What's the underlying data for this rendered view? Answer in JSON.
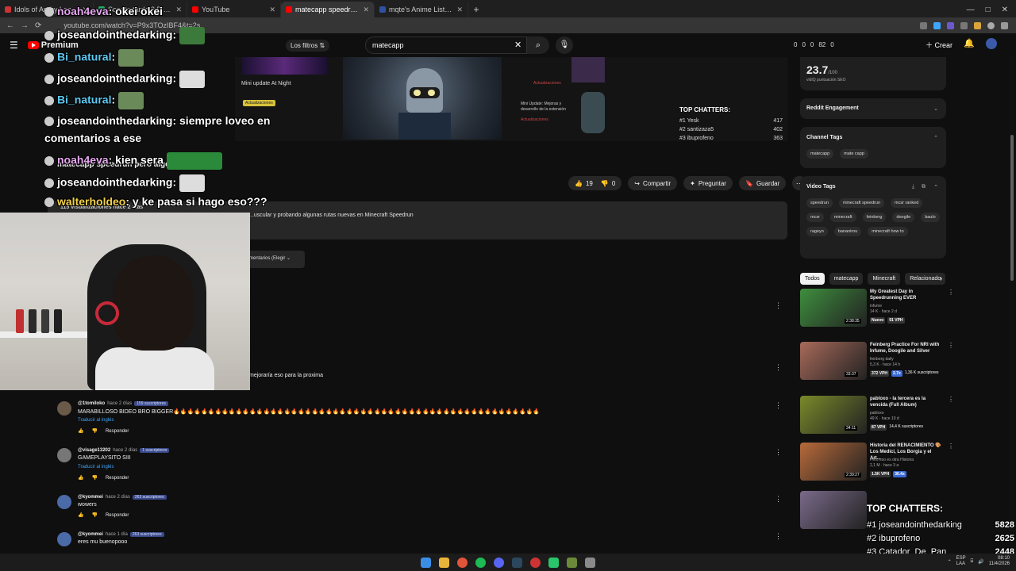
{
  "browser": {
    "tabs": [
      {
        "title": "Idols of Art by Leafy Gallery",
        "color": "#c33"
      },
      {
        "title": "Sonata tarde 3 Bidono de la",
        "color": "#2a6"
      },
      {
        "title": "YouTube",
        "color": "#f00"
      },
      {
        "title": "matecapp speedrun pero algo",
        "color": "#f00",
        "active": true
      },
      {
        "title": "mqte's Anime List - MyAnimeL",
        "color": "#2e51a2"
      }
    ],
    "url": "youtube.com/watch?v=P9x3TOzIBF4&t=2s"
  },
  "youtube": {
    "premium_label": "Premium",
    "filters_label": "Los filtros",
    "search_value": "matecapp",
    "header_stats": [
      "0",
      "0",
      "0",
      "82",
      "0"
    ],
    "create_label": "Crear"
  },
  "player": {
    "thumb_title": "Mini update At Night",
    "thumb_badge": "Actualizaciones",
    "panel_note": "Mini Update: Mejoras y desarrollo de la extensión",
    "panel_badge": "Actualizaciones",
    "panel_note2": "Actualizaciones",
    "top_chatters_title": "TOP CHATTERS:",
    "top_chatters": [
      {
        "rank": "#1 Yesk",
        "count": "417"
      },
      {
        "rank": "#2 santizaza5",
        "count": "402"
      },
      {
        "rank": "#3 ibuprofeno",
        "count": "363"
      }
    ]
  },
  "video": {
    "title": "matecapp speedrun pero algo",
    "views": "115 visualizaciones  hace 2 días",
    "description": "...uscular y probando algunas rutas nuevas en Minecraft Speedrun",
    "likes": "19",
    "dislikes": "0",
    "share_label": "Compartir",
    "ask_label": "Preguntar",
    "save_label": "Guardar",
    "sort_label": "mentarios (Elegir",
    "partial_comment": "mejoraría eso para la proxima"
  },
  "comments": [
    {
      "user": "@1tomiloko",
      "time": "hace 2 días",
      "subs": "159 suscriptores",
      "text": "MARABILLOSO BIDEO BRO BIGGER🔥🔥🔥🔥🔥🔥🔥🔥🔥🔥🔥🔥🔥🔥🔥🔥🔥🔥🔥🔥🔥🔥🔥🔥🔥🔥🔥🔥🔥🔥🔥🔥🔥🔥🔥🔥🔥🔥🔥🔥🔥🔥🔥🔥🔥🔥🔥🔥🔥🔥🔥🔥🔥",
      "translate": "Traducir al inglés",
      "reply": "Responder",
      "avatar_color": "#6a5a4a"
    },
    {
      "user": "@visage13202",
      "time": "hace 2 días",
      "subs": "1 suscriptores",
      "text": "GAMEPLAYSITO SIII",
      "translate": "Traducir al inglés",
      "reply": "Responder",
      "avatar_color": "#777"
    },
    {
      "user": "@kyommei",
      "time": "hace 2 días",
      "subs": "263 suscriptores",
      "text": "wowers",
      "translate": "",
      "reply": "Responder",
      "avatar_color": "#4a6aa8"
    },
    {
      "user": "@kyommei",
      "time": "hace 1 día",
      "subs": "263 suscriptores",
      "text": "eres mu buenopooo",
      "translate": "",
      "reply": "",
      "avatar_color": "#4a6aa8"
    }
  ],
  "sidebar": {
    "seo_score": "23.7",
    "seo_scale": "/100",
    "seo_label": "vidIQ puntuación SEO",
    "reddit_label": "Reddit Engagement",
    "channel_tags_label": "Channel Tags",
    "channel_tags": [
      "matecapp",
      "mate capp"
    ],
    "video_tags_label": "Video Tags",
    "video_tags": [
      "speedrun",
      "minecraft speedrun",
      "mcsr ranked",
      "mcsr",
      "minecraft",
      "feinberg",
      "doogile",
      "baulo",
      "rageyo",
      "bananirou",
      "minecraft how to"
    ],
    "chips": [
      "Todos",
      "matecapp",
      "Minecraft",
      "Relacionado"
    ],
    "recs": [
      {
        "title": "My Greatest Day in Speedrunning EVER",
        "channel": "infume",
        "meta": "14 K · hace 2 d",
        "extra": "Nuevo",
        "vph": "91 VPH",
        "badge": "",
        "subs": "",
        "duration": "2:38:35",
        "color": "#3e8e3e"
      },
      {
        "title": "Feinberg Practice For NRI with Infume, Doogile and Silver",
        "channel": "feinberg daily",
        "meta": "5,3 K · hace 14 h",
        "extra": "",
        "vph": "372 VPH",
        "badge": "2.7x",
        "subs": "1,36 K suscriptores",
        "duration": "33:37",
        "color": "#a86a5a"
      },
      {
        "title": "pabloxo - la tercera es la vencida (Full Album)",
        "channel": "pabloxo",
        "meta": "49 K · hace 10 d",
        "extra": "",
        "vph": "87 VPH",
        "badge": "",
        "subs": "14,4 K suscriptores",
        "duration": "34:11",
        "color": "#7a8a2a"
      },
      {
        "title": "Historia del RENACIMIENTO 🎨 Los Medici, Los Borgia y el Art...",
        "channel": "Pero eso es otra Historia",
        "meta": "2,1 M · hace 3 a",
        "extra": "",
        "vph": "1.5K VPH",
        "badge": "36.4x",
        "subs": "",
        "duration": "2:39:27",
        "color": "#b86a3a"
      },
      {
        "title": "",
        "channel": "",
        "meta": "",
        "extra": "",
        "vph": "",
        "badge": "",
        "subs": "",
        "duration": "",
        "color": "#7a6a8a"
      }
    ]
  },
  "overlay_chat": [
    {
      "name": "noah4eva",
      "text": ": okei okei",
      "name_color": "#e6a6f0",
      "emote": ""
    },
    {
      "name": "joseandointhedarking",
      "text": ":",
      "name_color": "#ffffff",
      "emote": "#3c7a3c"
    },
    {
      "name": "Bi_natural",
      "text": ":",
      "name_color": "#5ec8f0",
      "emote": "#6a8a5a"
    },
    {
      "name": "joseandointhedarking",
      "text": ":",
      "name_color": "#ffffff",
      "emote": "#ddd"
    },
    {
      "name": "Bi_natural",
      "text": ":",
      "name_color": "#5ec8f0",
      "emote": "#6a8a5a"
    },
    {
      "name": "joseandointhedarking",
      "text": ": siempre loveo en",
      "name_color": "#ffffff",
      "emote": ""
    },
    {
      "name": "",
      "text": "comentarios a ese",
      "name_color": "#ffffff",
      "emote": ""
    },
    {
      "name": "noah4eva",
      "text": ": kien sera",
      "name_color": "#e6a6f0",
      "emote": "#2a8a3a"
    },
    {
      "name": "joseandointhedarking",
      "text": ":",
      "name_color": "#ffffff",
      "emote": "#ddd"
    },
    {
      "name": "walterholdeo",
      "text": ": y ke pasa si hago eso???",
      "name_color": "#f2d24a",
      "emote": ""
    }
  ],
  "overlay_top": {
    "title": "TOP CHATTERS:",
    "rows": [
      {
        "rank": "#1 joseandointhedarking",
        "count": "5828"
      },
      {
        "rank": "#2 ibuprofeno",
        "count": "2625"
      },
      {
        "rank": "#3 Catador_De_Pan",
        "count": "2448"
      }
    ]
  },
  "taskbar": {
    "lang": "ESP\nLAA",
    "time": "08:10",
    "date": "11/4/2026"
  }
}
